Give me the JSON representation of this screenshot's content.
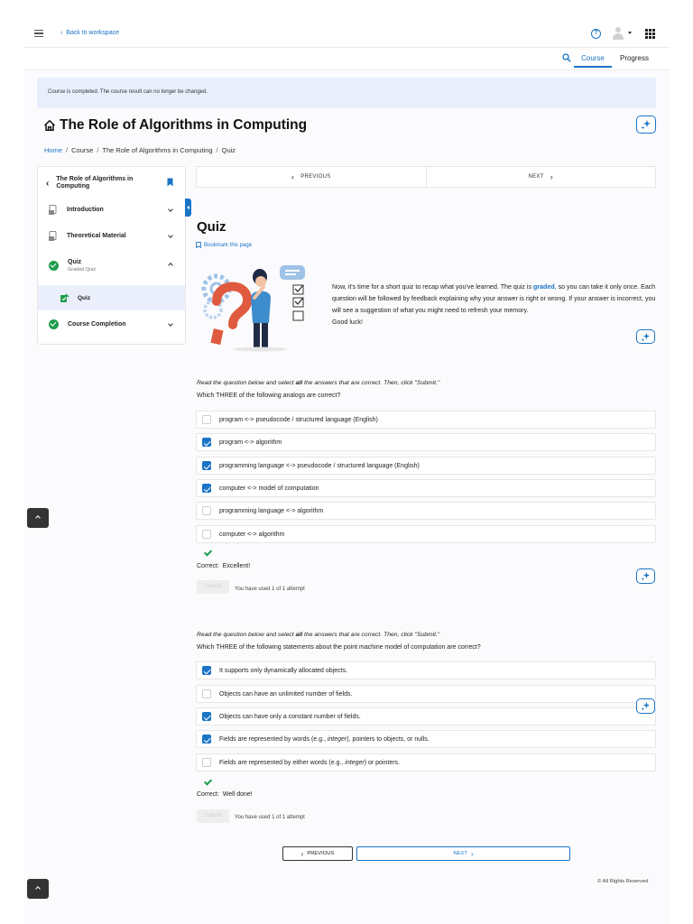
{
  "header": {
    "back_label": "Back to workspace",
    "tabs": [
      {
        "label": "Course",
        "active": true
      },
      {
        "label": "Progress",
        "active": false
      }
    ],
    "icons": [
      "menu-icon",
      "chevron-left-icon",
      "help-icon",
      "user-avatar-icon",
      "apps-grid-icon",
      "search-icon"
    ]
  },
  "alert": {
    "text": "Course is completed. The course result can no longer be changed."
  },
  "page": {
    "title": "The Role of Algorithms in Computing"
  },
  "breadcrumb": {
    "items": [
      "Home",
      "Course",
      "The Role of Algorithms in Computing",
      "Quiz"
    ],
    "separator": "/"
  },
  "sidebar": {
    "header": "The Role of Algorithms in Computing",
    "items": [
      {
        "label": "Introduction",
        "icon": "document-icon",
        "state": "collapsed"
      },
      {
        "label": "Theoretical Material",
        "icon": "document-icon",
        "state": "collapsed"
      },
      {
        "label": "Quiz",
        "sublabel": "Graded Quiz",
        "icon": "completed-check-icon",
        "state": "expanded"
      },
      {
        "label": "Course Completion",
        "icon": "completed-check-icon",
        "state": "collapsed"
      }
    ],
    "subitem": {
      "label": "Quiz",
      "icon": "quiz-icon"
    }
  },
  "nav": {
    "previous_label": "PREVIOUS",
    "next_label": "NEXT"
  },
  "quiz": {
    "title": "Quiz",
    "bookmark_label": "Bookmark this page",
    "intro_lines": [
      "Now, it's time for a short quiz to recap what you've learned. The quiz is",
      "graded",
      ", so you can take it only once. Each question will be followed by feedback explaining why your answer is right or wrong. If your answer is incorrect, you will see a suggestion of what you might need to refresh your memory.",
      "Good luck!"
    ]
  },
  "questions": [
    {
      "instruction_pre": "Read the question below and select ",
      "instruction_bold": "all",
      "instruction_post": " the answers that are correct. Then, click \"Submit.\"",
      "text": "Which THREE of the following analogs are correct?",
      "options": [
        {
          "label": "program <-> pseudocode / structured language (English)",
          "checked": false
        },
        {
          "label": "program <-> algorithm",
          "checked": true
        },
        {
          "label": "programming language <-> pseudocode / structured language (English)",
          "checked": true
        },
        {
          "label": "computer <-> model of computation",
          "checked": true
        },
        {
          "label": "programming language <-> algorithm",
          "checked": false
        },
        {
          "label": "computer <-> algorithm",
          "checked": false
        }
      ],
      "feedback_prefix": "Correct:",
      "feedback": "Excellent!",
      "submit_label": "Submit",
      "attempts": "You have used 1 of 1 attempt"
    },
    {
      "instruction_pre": "Read the question below and select ",
      "instruction_bold": "all",
      "instruction_post": " the answers that are correct. Then, click \"Submit.\"",
      "text": "Which THREE of the following statements about the point machine model of computation are correct?",
      "options": [
        {
          "label": "It supports only dynamically allocated objects.",
          "checked": true
        },
        {
          "label": "Objects can have an unlimited number of fields.",
          "checked": false
        },
        {
          "label": "Objects can have only a constant number of fields.",
          "checked": true
        },
        {
          "label_pre": "Fields are represented by words (e.g., ",
          "label_em": "integer",
          "label_post": "), pointers to objects, or nulls.",
          "checked": true
        },
        {
          "label_pre": "Fields are represented by either words (e.g., ",
          "label_em": "integer",
          "label_post": ") or pointers.",
          "checked": false
        }
      ],
      "feedback_prefix": "Correct:",
      "feedback": "Well done!",
      "submit_label": "Submit",
      "attempts": "You have used 1 of 1 attempt"
    }
  ],
  "bottom_nav": {
    "previous_label": "PREVIOUS",
    "next_label": "NEXT"
  },
  "footer": {
    "text": "All Rights Reserved"
  },
  "colors": {
    "accent": "#1b74c5",
    "success": "#1f9d4c",
    "alert_bg": "#e9eefc"
  }
}
